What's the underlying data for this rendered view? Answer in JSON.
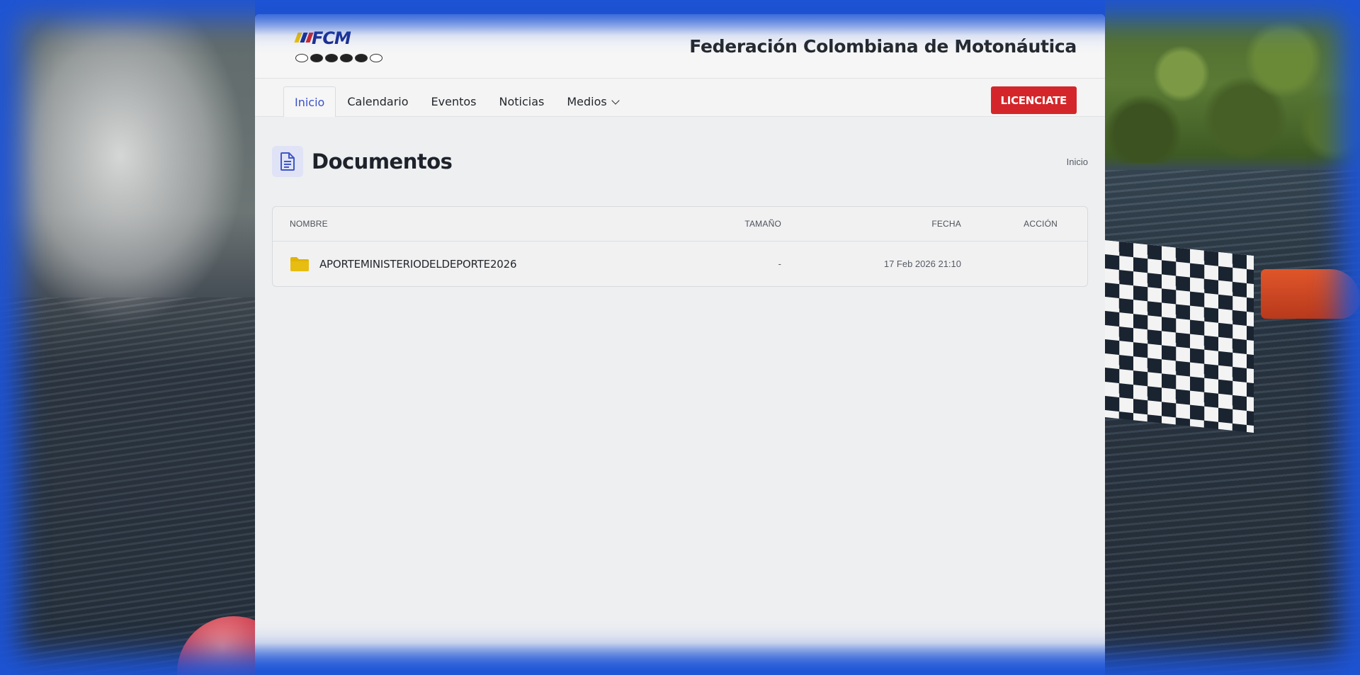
{
  "site": {
    "title": "Federación Colombiana de Motonáutica",
    "logo_text": "FCM"
  },
  "nav": {
    "items": [
      {
        "label": "Inicio",
        "active": true
      },
      {
        "label": "Calendario",
        "active": false
      },
      {
        "label": "Eventos",
        "active": false
      },
      {
        "label": "Noticias",
        "active": false
      },
      {
        "label": "Medios",
        "active": false,
        "dropdown": true
      }
    ],
    "cta_label": "LICENCIATE"
  },
  "page": {
    "title": "Documentos",
    "title_icon": "document-icon",
    "breadcrumb": "Inicio"
  },
  "table": {
    "columns": {
      "name": "NOMBRE",
      "size": "TAMAÑO",
      "date": "FECHA",
      "action": "ACCIÓN"
    },
    "rows": [
      {
        "icon": "folder-icon",
        "name": "APORTEMINISTERIODELDEPORTE2026",
        "size": "-",
        "date": "17 Feb 2026 21:10",
        "action": ""
      }
    ]
  },
  "colors": {
    "accent": "#3b52c8",
    "cta": "#d4262a",
    "folder": "#e2b300",
    "border_glow": "#1d54d6"
  }
}
